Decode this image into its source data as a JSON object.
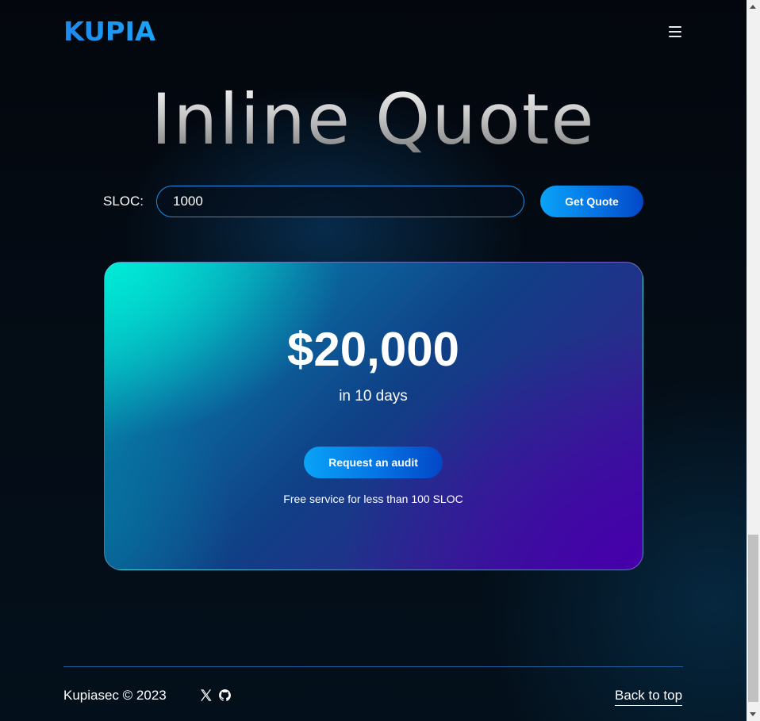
{
  "header": {
    "logo_text": "KUPIA",
    "menu_icon": "hamburger-menu-icon"
  },
  "hero": {
    "title": "Inline Quote"
  },
  "quote_form": {
    "label": "SLOC:",
    "input_value": "1000",
    "button_label": "Get Quote"
  },
  "result_card": {
    "price": "$20,000",
    "duration": "in 10 days",
    "cta_label": "Request an audit",
    "note": "Free service for less than 100 SLOC"
  },
  "footer": {
    "copyright": "Kupiasec © 2023",
    "social_icons": [
      "x-icon",
      "github-icon"
    ],
    "back_to_top": "Back to top"
  },
  "colors": {
    "accent": "#0a8ff0",
    "card_start": "#00e6d4",
    "card_end": "#3e05a6",
    "background": "#03070d"
  }
}
